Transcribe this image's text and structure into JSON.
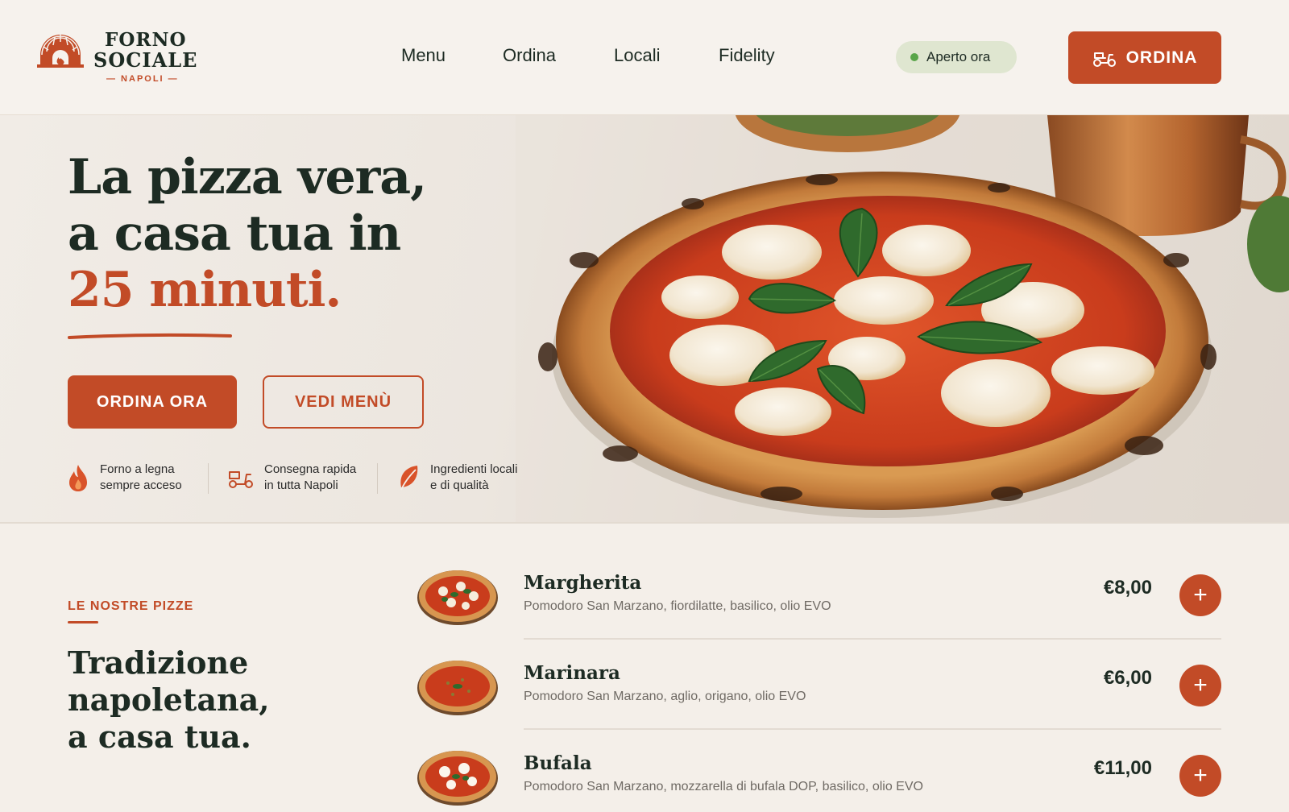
{
  "brand": {
    "line1": "FORNO",
    "line2": "SOCIALE",
    "sub": "— NAPOLI —",
    "logo_icon": "wood-oven-icon"
  },
  "nav": {
    "items": [
      {
        "label": "Menu"
      },
      {
        "label": "Ordina"
      },
      {
        "label": "Locali"
      },
      {
        "label": "Fidelity"
      }
    ]
  },
  "status": {
    "label": "Aperto ora",
    "color": "#58a548"
  },
  "header_cta": {
    "label": "ORDINA",
    "icon": "scooter-icon"
  },
  "hero": {
    "title_line1": "La pizza vera,",
    "title_line2": "a casa tua in",
    "title_accent": "25 minuti.",
    "primary_label": "ORDINA ORA",
    "secondary_label": "VEDI MENÙ",
    "image": "margherita-pizza-photo",
    "features": [
      {
        "icon": "flame-icon",
        "line1": "Forno a legna",
        "line2": "sempre acceso"
      },
      {
        "icon": "scooter-icon",
        "line1": "Consegna rapida",
        "line2": "in tutta Napoli"
      },
      {
        "icon": "leaf-icon",
        "line1": "Ingredienti locali",
        "line2": "e di qualità"
      }
    ]
  },
  "section": {
    "kicker": "LE NOSTRE PIZZE",
    "title_line1": "Tradizione",
    "title_line2": "napoletana,",
    "title_line3": "a casa tua."
  },
  "menu": {
    "items": [
      {
        "name": "Margherita",
        "desc": "Pomodoro San Marzano, fiordilatte, basilico, olio EVO",
        "price": "€8,00",
        "add": "+"
      },
      {
        "name": "Marinara",
        "desc": "Pomodoro San Marzano, aglio, origano, olio EVO",
        "price": "€6,00",
        "add": "+"
      },
      {
        "name": "Bufala",
        "desc": "Pomodoro San Marzano, mozzarella di bufala DOP, basilico, olio EVO",
        "price": "€11,00",
        "add": "+"
      }
    ]
  },
  "colors": {
    "accent": "#c24b27",
    "dark": "#1d2b23",
    "status_green": "#58a548"
  }
}
